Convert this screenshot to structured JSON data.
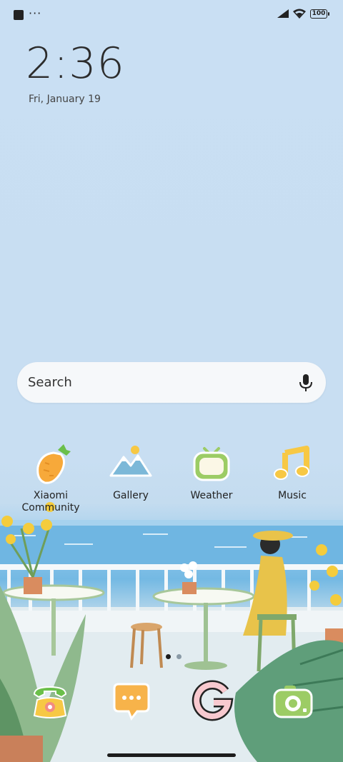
{
  "status_bar": {
    "more": "···",
    "battery": "100"
  },
  "lockscreen": {
    "time": "2:36",
    "date": "Fri, January 19"
  },
  "search": {
    "placeholder": "Search"
  },
  "apps": [
    {
      "label": "Xiaomi Community",
      "icon": "carrot-icon"
    },
    {
      "label": "Gallery",
      "icon": "mountain-icon"
    },
    {
      "label": "Weather",
      "icon": "tv-icon"
    },
    {
      "label": "Music",
      "icon": "music-note-icon"
    }
  ],
  "dock": [
    {
      "icon": "phone-icon"
    },
    {
      "icon": "messages-icon"
    },
    {
      "icon": "google-icon"
    },
    {
      "icon": "camera-icon"
    }
  ],
  "page_indicator": {
    "pages": 2,
    "current": 1
  },
  "colors": {
    "background": "#c9dff3",
    "search_bg": "#f6f8fa",
    "accent_yellow": "#f7c844",
    "accent_green": "#9ccc65"
  }
}
